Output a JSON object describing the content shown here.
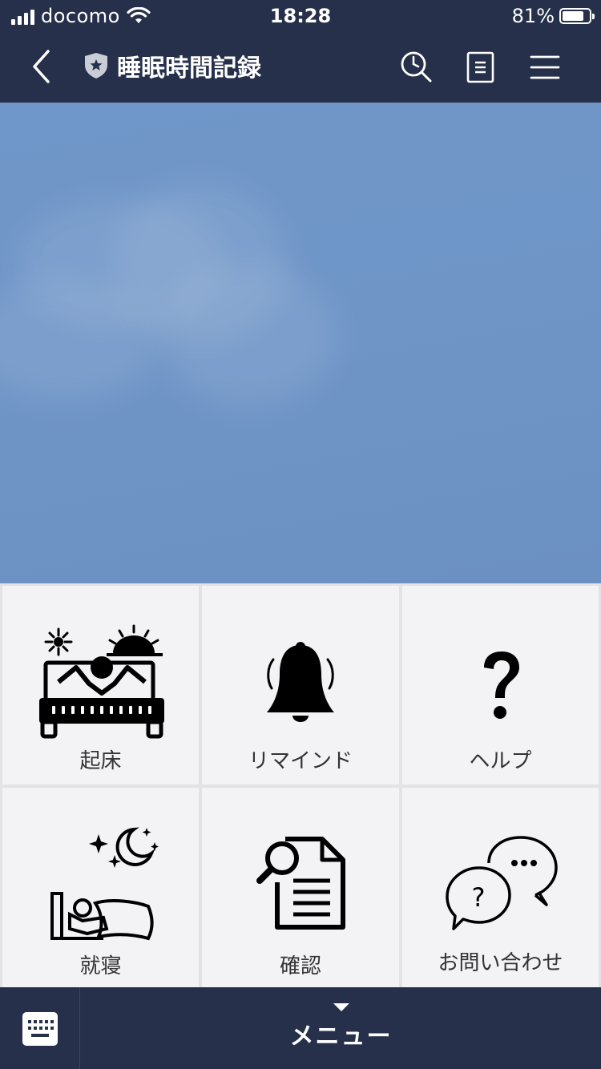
{
  "status_bar": {
    "carrier": "docomo",
    "time": "18:28",
    "battery": "81%",
    "battery_level": 0.81
  },
  "header": {
    "title": "睡眠時間記録",
    "icons": [
      "back-icon",
      "shield-star-icon",
      "search-clock-icon",
      "notes-icon",
      "menu-icon"
    ]
  },
  "rich_menu": {
    "items": [
      {
        "label": "起床",
        "icon": "wake-up-bed-sunrise-icon"
      },
      {
        "label": "リマインド",
        "icon": "bell-icon"
      },
      {
        "label": "ヘルプ",
        "icon": "question-mark-icon"
      },
      {
        "label": "就寝",
        "icon": "sleep-moon-icon"
      },
      {
        "label": "確認",
        "icon": "document-search-icon"
      },
      {
        "label": "お問い合わせ",
        "icon": "chat-bubbles-icon"
      }
    ]
  },
  "bottom_bar": {
    "menu_label": "メニュー",
    "keyboard_icon": "keyboard-icon"
  },
  "colors": {
    "bar_background": "#26304a",
    "hero_background": "#6f95c7",
    "cell_background": "#f3f3f5"
  }
}
